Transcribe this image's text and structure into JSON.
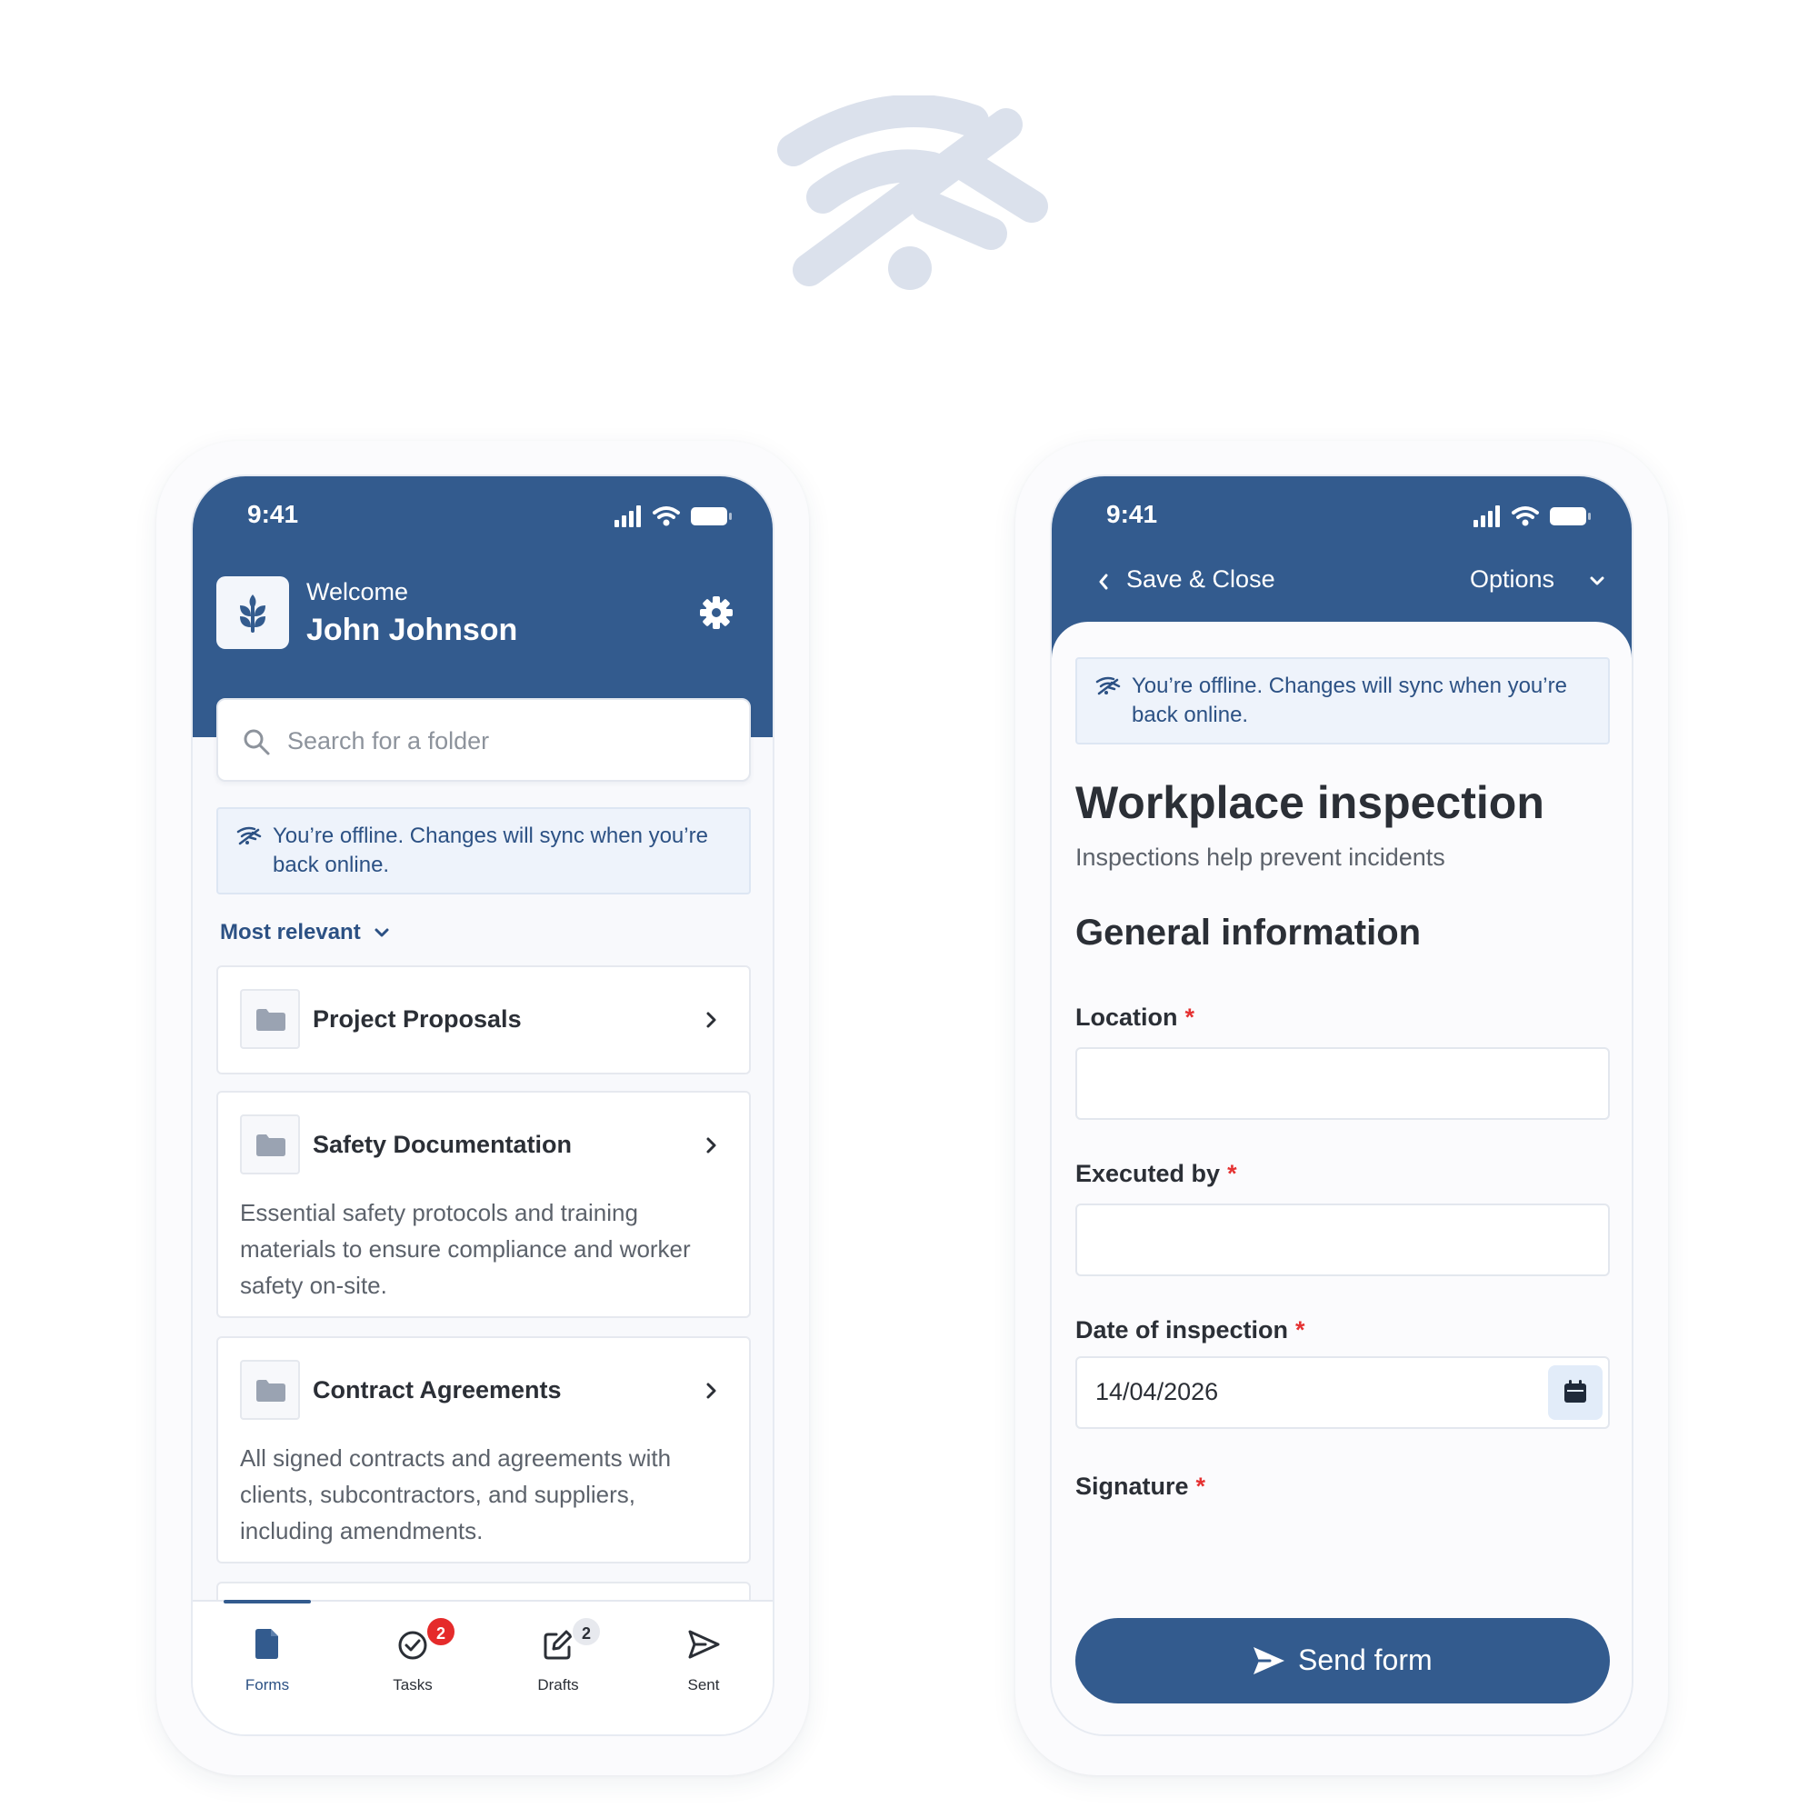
{
  "colors": {
    "primary": "#335b8e",
    "primary_text": "#2c5184",
    "offline_bg": "#eef3fb",
    "badge_red": "#e52b2b",
    "required": "#e53232",
    "hero_icon": "#dbe1ec"
  },
  "hero": {
    "icon": "wifi-off-icon"
  },
  "home": {
    "status_time": "9:41",
    "welcome": "Welcome",
    "user_name": "John Johnson",
    "search": {
      "placeholder": "Search for a folder"
    },
    "offline_message": "You’re offline. Changes will sync when you’re back online.",
    "sort_label": "Most relevant",
    "folders": [
      {
        "title": "Project Proposals",
        "description": ""
      },
      {
        "title": "Safety Documentation",
        "description": "Essential safety protocols and training materials to ensure compliance and worker safety on-site."
      },
      {
        "title": "Contract Agreements",
        "description": "All signed contracts and agreements with clients, subcontractors, and suppliers, including amendments."
      }
    ],
    "tabs": [
      {
        "label": "Forms",
        "icon": "document-icon",
        "active": true
      },
      {
        "label": "Tasks",
        "icon": "check-circle-icon",
        "badge": "2"
      },
      {
        "label": "Drafts",
        "icon": "edit-icon",
        "badge": "2"
      },
      {
        "label": "Sent",
        "icon": "send-icon"
      }
    ]
  },
  "form": {
    "status_time": "9:41",
    "back_label": "Save & Close",
    "options_label": "Options",
    "offline_message": "You’re offline. Changes will sync when you’re back online.",
    "title": "Workplace inspection",
    "subtitle": "Inspections help prevent incidents",
    "section_title": "General information",
    "required_mark": "*",
    "fields": {
      "location": {
        "label": "Location",
        "value": ""
      },
      "executed_by": {
        "label": "Executed by",
        "value": ""
      },
      "date": {
        "label": "Date of inspection",
        "value": "14/04/2026"
      },
      "signature": {
        "label": "Signature"
      }
    },
    "submit_label": "Send form"
  }
}
